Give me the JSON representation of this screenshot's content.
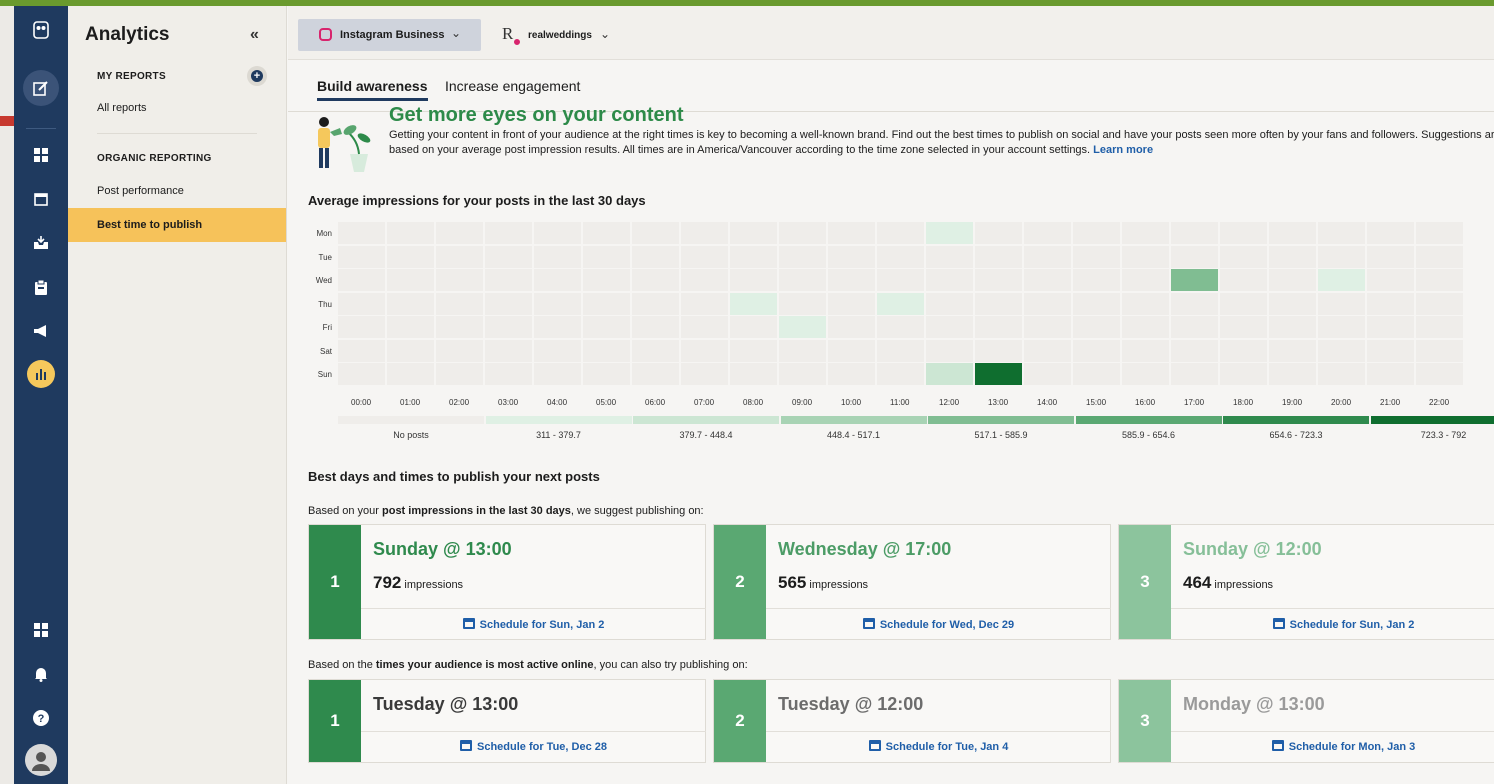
{
  "nav": {
    "icons": [
      "owl-logo",
      "compose-icon",
      "dashboard-icon",
      "calendar-icon",
      "inbox-icon",
      "clipboard-icon",
      "megaphone-icon",
      "analytics-icon",
      "apps-icon",
      "bell-icon",
      "help-icon",
      "profile-icon"
    ]
  },
  "sidebar": {
    "title": "Analytics",
    "collapse_glyph": "«",
    "my_reports_heading": "MY REPORTS",
    "all_reports": "All reports",
    "organic_heading": "ORGANIC REPORTING",
    "post_performance": "Post performance",
    "best_time": "Best time to publish"
  },
  "header": {
    "account": "Instagram Business",
    "profile_initial": "R",
    "profile_name": "realweddings"
  },
  "tabs": [
    "Build awareness",
    "Increase engagement"
  ],
  "intro": {
    "title": "Get more eyes on your content",
    "text_line1": "Getting your content in front of your audience at the right times is key to becoming a well-known brand. Find out the best times to publish on social and have your posts seen more often by your fans and followers. Suggestions ar",
    "text_line2": "based on your average post impression results. All times are in America/Vancouver according to the time zone selected in your account settings.",
    "learn_more": "Learn more"
  },
  "heatmap": {
    "title": "Average impressions for your posts in the last 30 days",
    "days": [
      "Mon",
      "Tue",
      "Wed",
      "Thu",
      "Fri",
      "Sat",
      "Sun"
    ],
    "hours": [
      "00:00",
      "01:00",
      "02:00",
      "03:00",
      "04:00",
      "05:00",
      "06:00",
      "07:00",
      "08:00",
      "09:00",
      "10:00",
      "11:00",
      "12:00",
      "13:00",
      "14:00",
      "15:00",
      "16:00",
      "17:00",
      "18:00",
      "19:00",
      "20:00",
      "21:00",
      "22:00"
    ],
    "cells": [
      {
        "day": 0,
        "hour": 12,
        "level": 1
      },
      {
        "day": 2,
        "hour": 17,
        "level": 4
      },
      {
        "day": 2,
        "hour": 20,
        "level": 1
      },
      {
        "day": 3,
        "hour": 8,
        "level": 1
      },
      {
        "day": 3,
        "hour": 11,
        "level": 1
      },
      {
        "day": 4,
        "hour": 9,
        "level": 1
      },
      {
        "day": 6,
        "hour": 12,
        "level": 2
      },
      {
        "day": 6,
        "hour": 13,
        "level": 7
      }
    ],
    "legend": [
      "No posts",
      "311 - 379.7",
      "379.7 - 448.4",
      "448.4 - 517.1",
      "517.1 - 585.9",
      "585.9 - 654.6",
      "654.6 - 723.3",
      "723.3 - 792"
    ],
    "colors": [
      "#efedea",
      "#dff0e4",
      "#cce6d3",
      "#a8d3b4",
      "#80bd92",
      "#5aa872",
      "#2f8a4d",
      "#0f6e2f"
    ]
  },
  "best": {
    "title": "Best days and times to publish your next posts",
    "based_impressions_pre": "Based on your ",
    "based_impressions_bold": "post impressions in the last 30 days",
    "based_impressions_post": ", we suggest publishing on:",
    "impressions_label": "impressions",
    "cards": [
      {
        "rank": "1",
        "when": "Sunday @ 13:00",
        "count": "792",
        "schedule": "Schedule for Sun, Jan 2",
        "color": "#2f8a4d",
        "title_color": "#2f8a4d"
      },
      {
        "rank": "2",
        "when": "Wednesday @ 17:00",
        "count": "565",
        "schedule": "Schedule for Wed, Dec 29",
        "color": "#5aa872",
        "title_color": "#4c9c66"
      },
      {
        "rank": "3",
        "when": "Sunday @ 12:00",
        "count": "464",
        "schedule": "Schedule for Sun, Jan 2",
        "color": "#8cc49d",
        "title_color": "#86bf98"
      }
    ],
    "based_active_pre": "Based on the ",
    "based_active_bold": "times your audience is most active online",
    "based_active_post": ", you can also try publishing on:",
    "active_cards": [
      {
        "rank": "1",
        "when": "Tuesday @ 13:00",
        "schedule": "Schedule for Tue, Dec 28",
        "color": "#2f8a4d",
        "title_color": "#3a3a3a"
      },
      {
        "rank": "2",
        "when": "Tuesday @ 12:00",
        "schedule": "Schedule for Tue, Jan 4",
        "color": "#5aa872",
        "title_color": "#6c6c6c"
      },
      {
        "rank": "3",
        "when": "Monday @ 13:00",
        "schedule": "Schedule for Mon, Jan 3",
        "color": "#8cc49d",
        "title_color": "#9a9a9a"
      }
    ]
  }
}
